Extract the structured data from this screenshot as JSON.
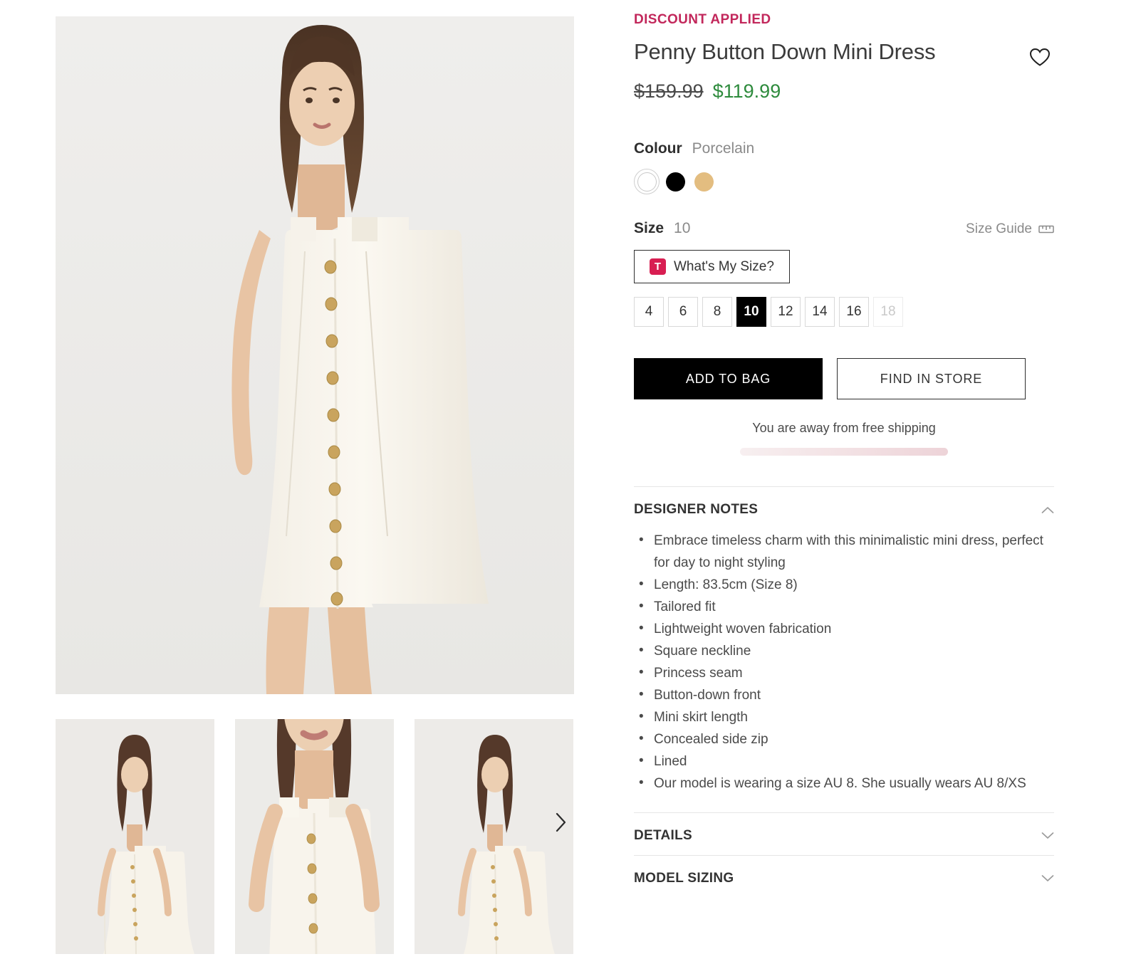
{
  "badge": {
    "discount_applied": "DISCOUNT APPLIED"
  },
  "product": {
    "title": "Penny Button Down Mini Dress",
    "price_was": "$159.99",
    "price_now": "$119.99"
  },
  "wishlist": {
    "icon": "heart-icon"
  },
  "colour": {
    "label": "Colour",
    "selected": "Porcelain",
    "swatches": [
      {
        "name": "Porcelain",
        "hex": "#ffffff",
        "selected": true
      },
      {
        "name": "Black",
        "hex": "#000000",
        "selected": false
      },
      {
        "name": "Tan",
        "hex": "#e3bd80",
        "selected": false
      }
    ]
  },
  "size": {
    "label": "Size",
    "selected": "10",
    "size_guide_label": "Size Guide",
    "size_guide_icon": "ruler-icon",
    "whats_my_size_label": "What's My Size?",
    "whats_my_size_icon": "true-fit-t-logo",
    "brand_accent": "#d81e52",
    "options": [
      {
        "value": "4",
        "selected": false,
        "disabled": false
      },
      {
        "value": "6",
        "selected": false,
        "disabled": false
      },
      {
        "value": "8",
        "selected": false,
        "disabled": false
      },
      {
        "value": "10",
        "selected": true,
        "disabled": false
      },
      {
        "value": "12",
        "selected": false,
        "disabled": false
      },
      {
        "value": "14",
        "selected": false,
        "disabled": false
      },
      {
        "value": "16",
        "selected": false,
        "disabled": false
      },
      {
        "value": "18",
        "selected": false,
        "disabled": true
      }
    ]
  },
  "actions": {
    "add_to_bag": "ADD TO BAG",
    "find_in_store": "FIND IN STORE"
  },
  "shipping": {
    "message": "You are away from free shipping"
  },
  "accordion": [
    {
      "title": "DESIGNER NOTES",
      "expanded": true,
      "chevron": "chevron-up-icon",
      "items": [
        "Embrace timeless charm with this minimalistic mini dress, perfect for day to night styling",
        "Length: 83.5cm (Size 8)",
        "Tailored fit",
        "Lightweight woven fabrication",
        "Square neckline",
        "Princess seam",
        "Button-down front",
        "Mini skirt length",
        "Concealed side zip",
        "Lined",
        "Our model is wearing a size AU 8. She usually wears AU 8/XS"
      ]
    },
    {
      "title": "DETAILS",
      "expanded": false,
      "chevron": "chevron-down-icon",
      "items": []
    },
    {
      "title": "MODEL SIZING",
      "expanded": false,
      "chevron": "chevron-down-icon",
      "items": []
    }
  ],
  "gallery": {
    "next_label": "Next image",
    "next_icon": "chevron-right-icon",
    "hero_alt": "Model wearing ivory Penny button down mini dress, full length front view",
    "thumbs": [
      "Model full length front view",
      "Close up of neckline and bodice",
      "Model three quarter view"
    ]
  }
}
